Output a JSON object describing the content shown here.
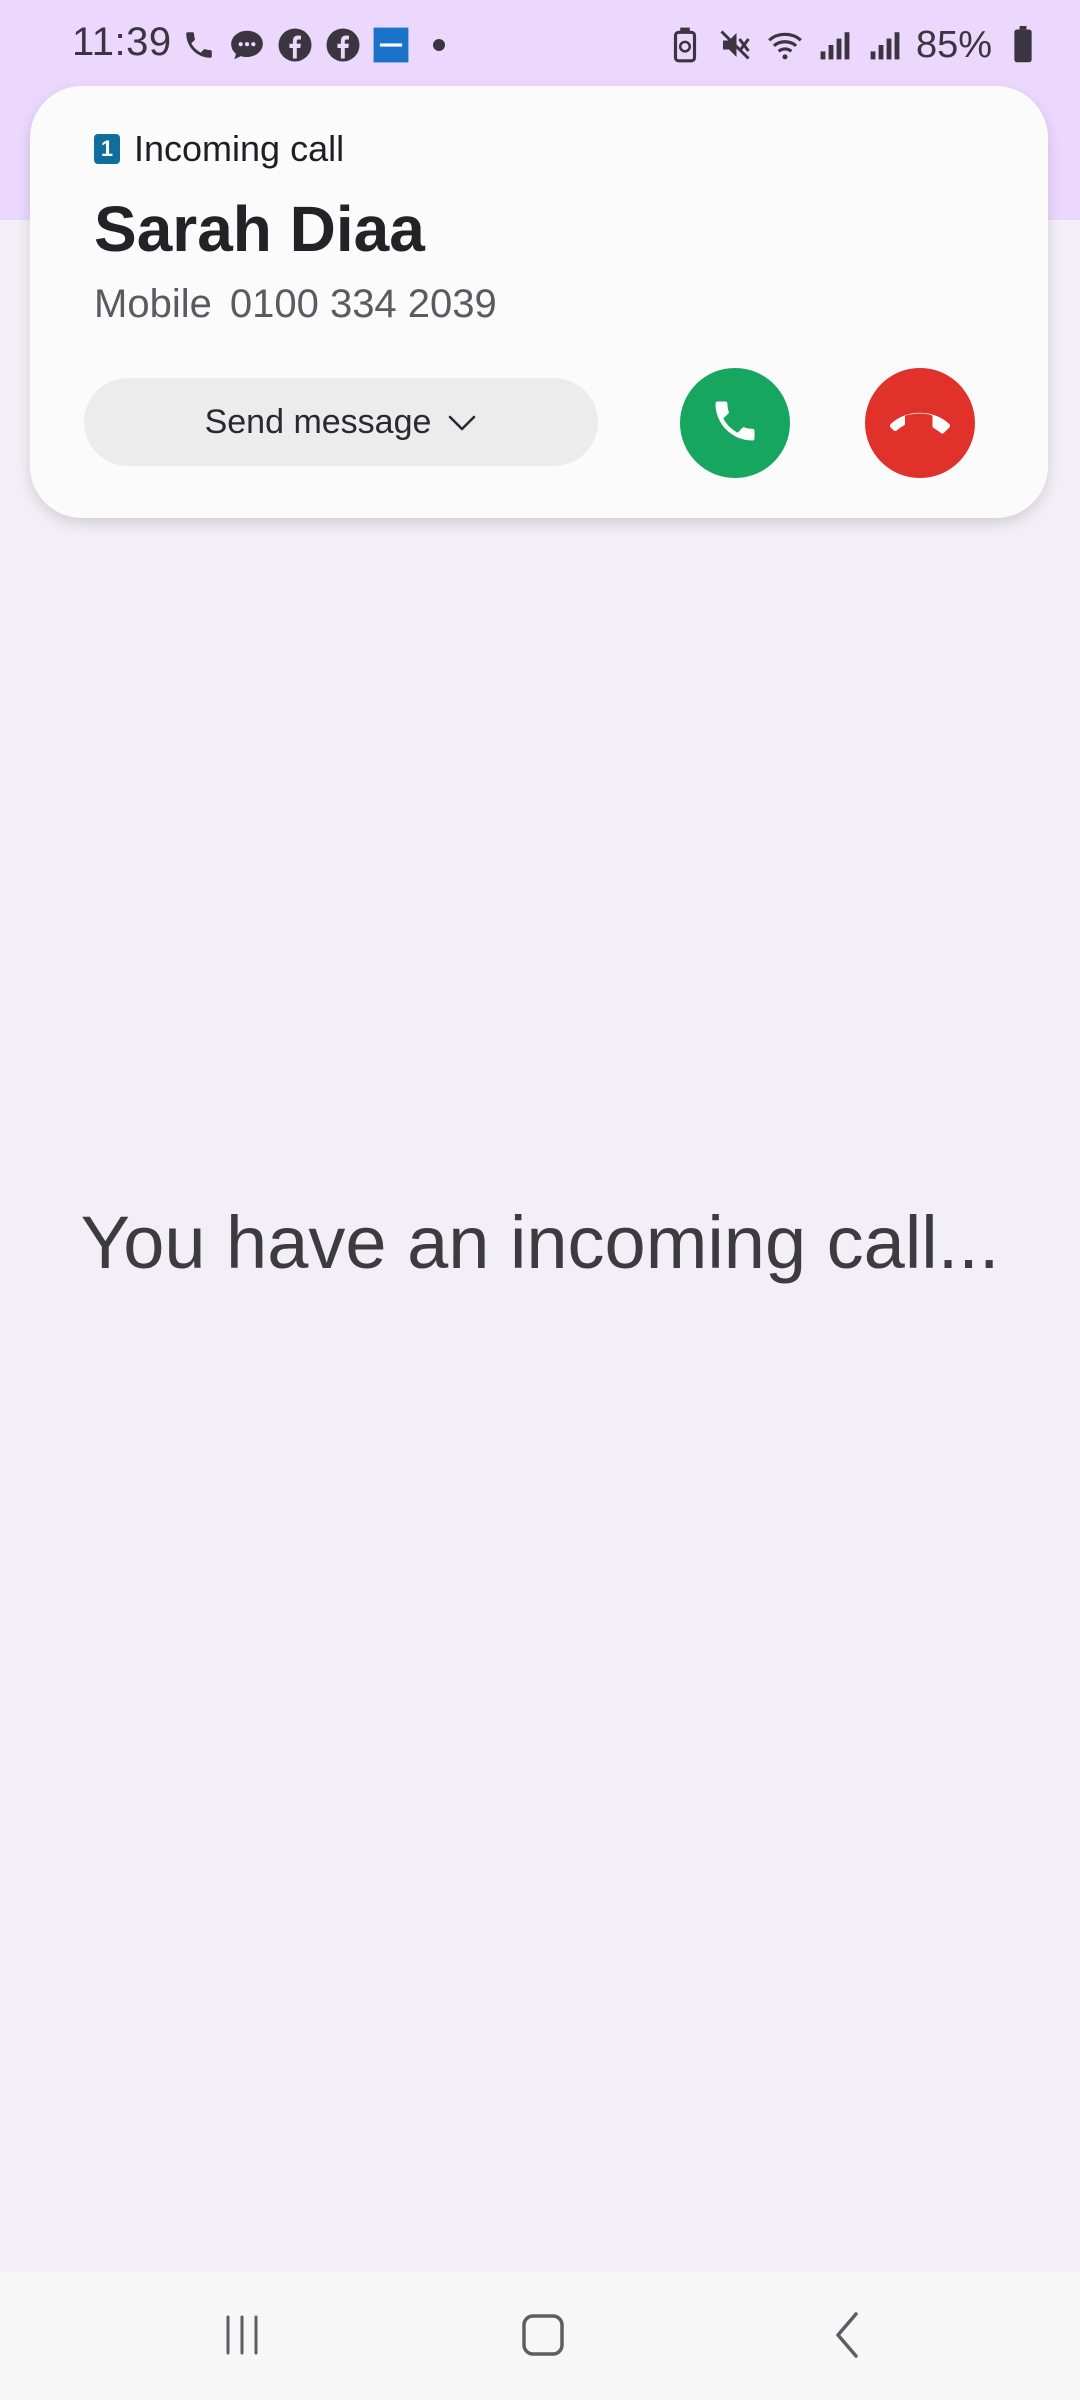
{
  "status_bar": {
    "time": "11:39",
    "left_icons": [
      "phone-icon",
      "messages-icon",
      "facebook-icon",
      "facebook-icon",
      "bank-app-icon",
      "more-dot-icon"
    ],
    "right_icons": [
      "battery-saver-icon",
      "mute-icon",
      "wifi-icon",
      "signal-icon",
      "signal-icon",
      "battery-icon"
    ],
    "battery": "85%"
  },
  "call_card": {
    "sim": "1",
    "header": "Incoming call",
    "caller_name": "Sarah Diaa",
    "number_type": "Mobile",
    "number": "0100 334 2039",
    "send_message_label": "Send message",
    "answer_icon": "phone-answer-icon",
    "decline_icon": "phone-decline-icon"
  },
  "main": {
    "message": "You have an incoming call..."
  },
  "nav_bar": {
    "recents_icon": "recents-icon",
    "home_icon": "home-icon",
    "back_icon": "back-icon"
  },
  "colors": {
    "top_tint": "#ecd7fd",
    "background": "#f2f0f6",
    "answer": "#17a660",
    "decline": "#e0312b",
    "sim_badge": "#0f6e9e"
  }
}
